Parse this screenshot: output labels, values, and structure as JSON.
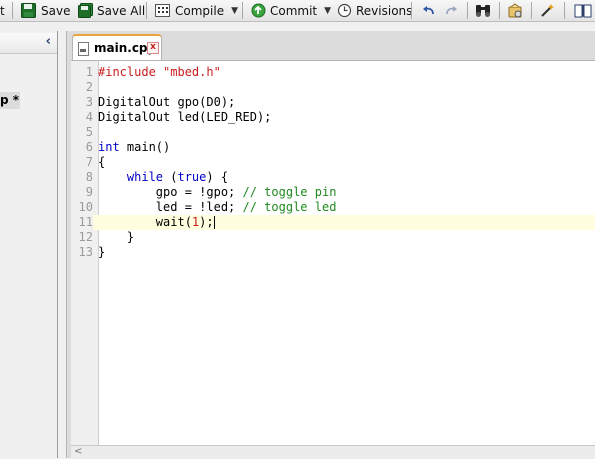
{
  "toolbar": {
    "partial_label": "t",
    "save_label": "Save",
    "save_all_label": "Save All",
    "compile_label": "Compile",
    "commit_label": "Commit",
    "revisions_label": "Revisions",
    "icons": [
      "save-icon",
      "save-all-icon",
      "compile-icon",
      "commit-icon",
      "revisions-icon",
      "undo-icon",
      "redo-icon",
      "find-icon",
      "format-icon",
      "wand-icon",
      "book-icon"
    ]
  },
  "left_panel": {
    "collapse_glyph": "‹",
    "tree_item": "p *"
  },
  "editor": {
    "tab_label": "main.cpp",
    "tab_close": "x",
    "active_line": 11,
    "lines": [
      {
        "n": "1",
        "tokens": [
          {
            "t": "#include ",
            "c": "kw-pre"
          },
          {
            "t": "\"mbed.h\"",
            "c": "str"
          }
        ]
      },
      {
        "n": "2",
        "tokens": []
      },
      {
        "n": "3",
        "tokens": [
          {
            "t": "DigitalOut gpo(D0);",
            "c": ""
          }
        ]
      },
      {
        "n": "4",
        "tokens": [
          {
            "t": "DigitalOut led(LED_RED);",
            "c": ""
          }
        ]
      },
      {
        "n": "5",
        "tokens": []
      },
      {
        "n": "6",
        "tokens": [
          {
            "t": "int",
            "c": "kw"
          },
          {
            "t": " main()",
            "c": ""
          }
        ]
      },
      {
        "n": "7",
        "tokens": [
          {
            "t": "{",
            "c": ""
          }
        ]
      },
      {
        "n": "8",
        "tokens": [
          {
            "t": "    ",
            "c": ""
          },
          {
            "t": "while",
            "c": "kw"
          },
          {
            "t": " (",
            "c": ""
          },
          {
            "t": "true",
            "c": "kw"
          },
          {
            "t": ") {",
            "c": ""
          }
        ]
      },
      {
        "n": "9",
        "tokens": [
          {
            "t": "        gpo = !gpo; ",
            "c": ""
          },
          {
            "t": "// toggle pin",
            "c": "cmt"
          }
        ]
      },
      {
        "n": "10",
        "tokens": [
          {
            "t": "        led = !led; ",
            "c": ""
          },
          {
            "t": "// toggle led",
            "c": "cmt"
          }
        ]
      },
      {
        "n": "11",
        "tokens": [
          {
            "t": "        wait(",
            "c": ""
          },
          {
            "t": "1",
            "c": "numlit"
          },
          {
            "t": ");",
            "c": ""
          }
        ]
      },
      {
        "n": "12",
        "tokens": [
          {
            "t": "    }",
            "c": ""
          }
        ]
      },
      {
        "n": "13",
        "tokens": [
          {
            "t": "}",
            "c": ""
          }
        ]
      }
    ]
  },
  "colors": {
    "keyword": "#0000c8",
    "string": "#c81e1e",
    "comment": "#1f8a1f",
    "active_line": "#ffffdf",
    "tab_accent": "#e8a33a"
  }
}
